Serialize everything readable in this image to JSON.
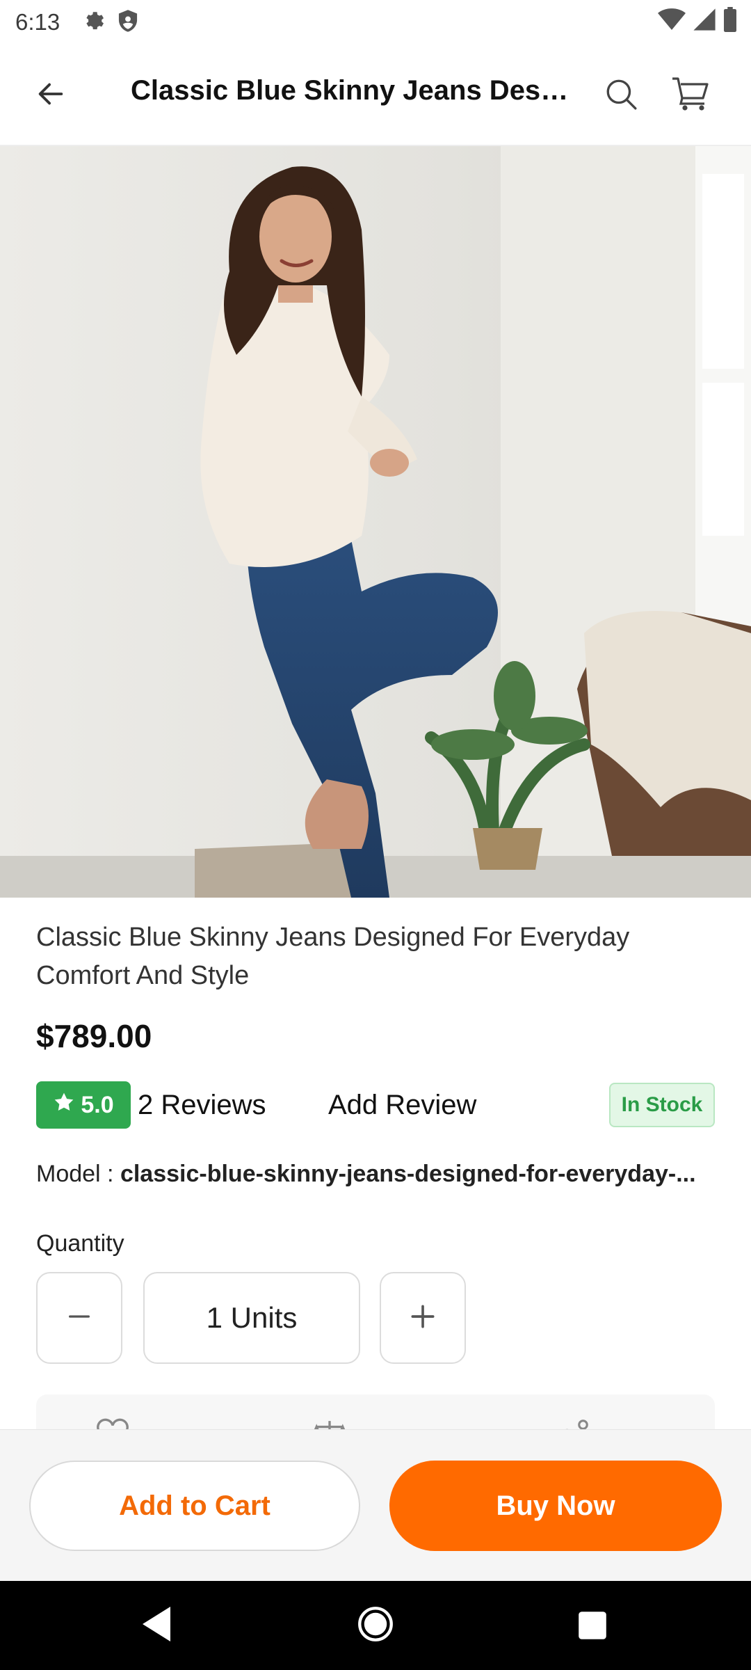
{
  "status_bar": {
    "time": "6:13",
    "icons_left": [
      "gear-icon",
      "shield-icon"
    ],
    "icons_right": [
      "wifi-icon",
      "signal-icon",
      "battery-icon"
    ]
  },
  "app_bar": {
    "title": "Classic Blue Skinny Jeans Desi...",
    "icons": [
      "back-arrow-icon",
      "search-icon",
      "cart-icon"
    ]
  },
  "product": {
    "title": "Classic Blue Skinny Jeans Designed For Everyday Comfort And Style",
    "price": "$789.00",
    "rating": "5.0",
    "reviews": "2 Reviews",
    "add_review": "Add Review",
    "stock": "In Stock",
    "model_label": "Model : ",
    "model_value": "classic-blue-skinny-jeans-designed-for-everyday-...",
    "quantity_label": "Quantity",
    "quantity_value": "1 Units"
  },
  "actions": {
    "add_to_cart": "Add to Cart",
    "buy_now": "Buy Now"
  },
  "colors": {
    "accent": "#ff6a00",
    "rating_green": "#2fa84f",
    "stock_green": "#2a9c47"
  }
}
